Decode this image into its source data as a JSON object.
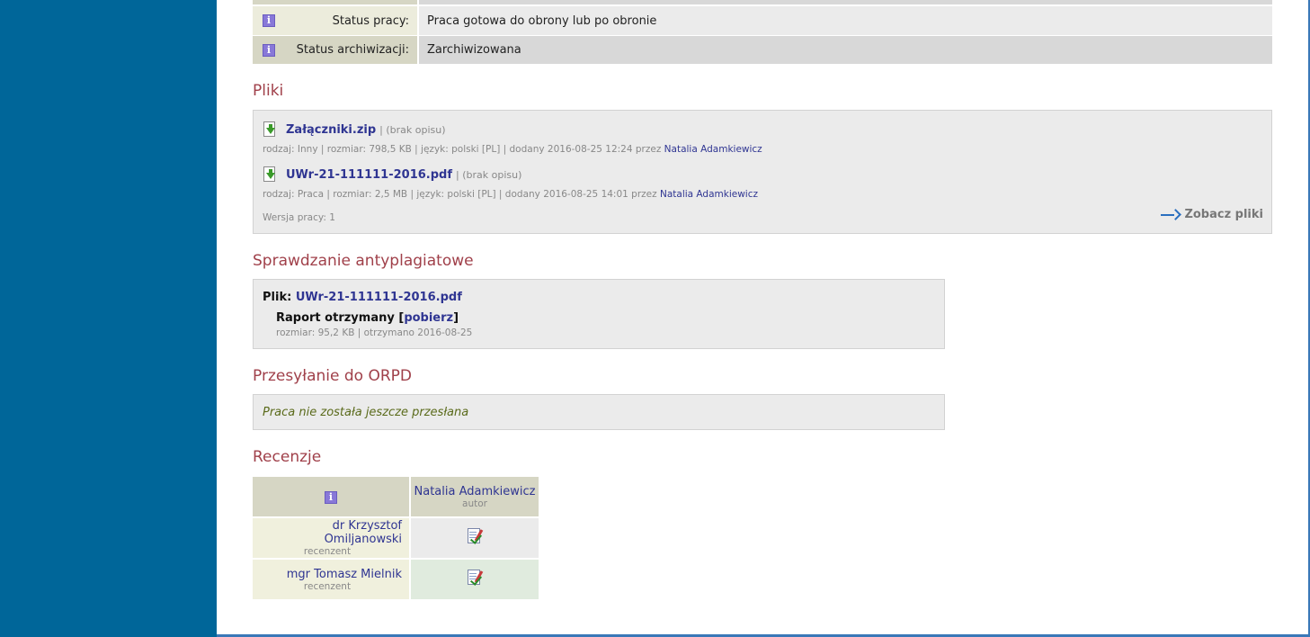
{
  "status": {
    "rows": [
      {
        "label": "Status pracy:",
        "value": "Praca gotowa do obrony lub po obronie"
      },
      {
        "label": "Status archiwizacji:",
        "value": "Zarchiwizowana"
      }
    ],
    "info_glyph": "i"
  },
  "files": {
    "heading": "Pliki",
    "items": [
      {
        "name": "Załączniki.zip",
        "desc": "| (brak opisu)",
        "meta": "rodzaj: Inny | rozmiar: 798,5 KB | język: polski [PL] | dodany 2016-08-25 12:24 przez",
        "author": "Natalia Adamkiewicz"
      },
      {
        "name": "UWr-21-111111-2016.pdf",
        "desc": "| (brak opisu)",
        "meta": "rodzaj: Praca | rozmiar: 2,5 MB | język: polski [PL] | dodany 2016-08-25 14:01 przez",
        "author": "Natalia Adamkiewicz"
      }
    ],
    "version": "Wersja pracy: 1",
    "see_files": "Zobacz pliki"
  },
  "antiplagiarism": {
    "heading": "Sprawdzanie antyplagiatowe",
    "file_label": "Plik:",
    "file_name": "UWr-21-111111-2016.pdf",
    "report_text": "Raport otrzymany",
    "download": "pobierz",
    "meta": "rozmiar: 95,2 KB | otrzymano 2016-08-25"
  },
  "orpd": {
    "heading": "Przesyłanie do ORPD",
    "message": "Praca nie została jeszcze przesłana"
  },
  "reviews": {
    "heading": "Recenzje",
    "author": {
      "name": "Natalia Adamkiewicz",
      "role": "autor"
    },
    "reviewers": [
      {
        "name": "dr Krzysztof Omiljanowski",
        "role": "recenzent"
      },
      {
        "name": "mgr Tomasz Mielnik",
        "role": "recenzent"
      }
    ]
  }
}
